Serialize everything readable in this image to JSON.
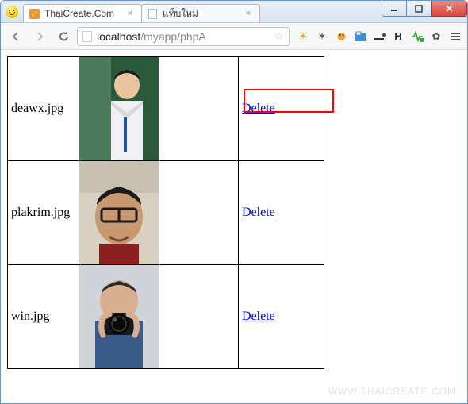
{
  "window": {
    "tabs": [
      {
        "title": "ThaiCreate.Com",
        "icon": "xampp",
        "active": true
      },
      {
        "title": "แท็บใหม่",
        "icon": "page",
        "active": false
      }
    ],
    "controls": {
      "min": "–",
      "max": "▢",
      "close": "✕"
    }
  },
  "toolbar": {
    "url_host": "localhost",
    "url_path": "/myapp/phpA",
    "icons": {
      "back": "←",
      "forward": "→",
      "reload": "↻",
      "extensions": [
        "sun",
        "bug",
        "beetle",
        "shot",
        "minus",
        "H",
        "pulse",
        "gear",
        "menu"
      ]
    }
  },
  "table": {
    "delete_label": "Delete",
    "rows": [
      {
        "filename": "deawx.jpg",
        "highlight": true
      },
      {
        "filename": "plakrim.jpg",
        "highlight": false
      },
      {
        "filename": "win.jpg",
        "highlight": false
      }
    ]
  },
  "watermark": "WWW.THAICREATE.COM"
}
